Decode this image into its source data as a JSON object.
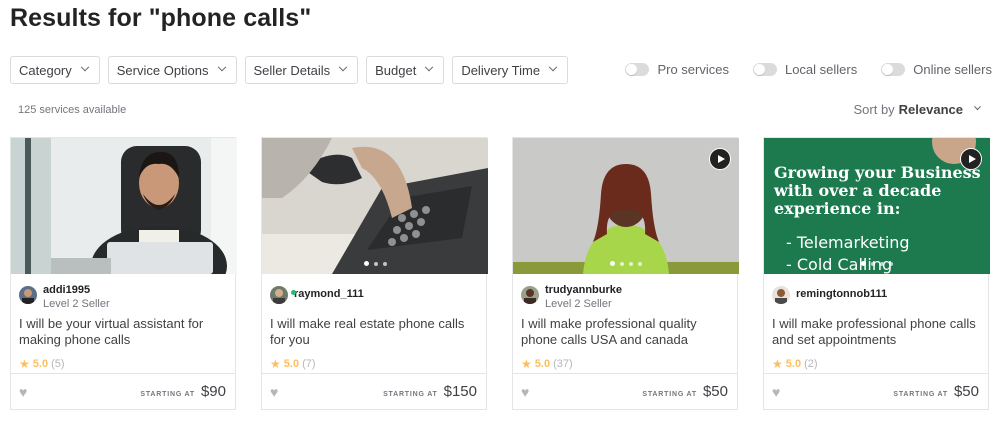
{
  "page": {
    "title": "Results for \"phone calls\""
  },
  "filters": [
    "Category",
    "Service Options",
    "Seller Details",
    "Budget",
    "Delivery Time"
  ],
  "toggles": [
    "Pro services",
    "Local sellers",
    "Online sellers"
  ],
  "results": {
    "count_label": "125 services available",
    "sort_prefix": "Sort by",
    "sort_value": "Relevance"
  },
  "cards": [
    {
      "seller": "addi1995",
      "level": "Level 2 Seller",
      "title": "I will be your virtual assistant for making phone calls",
      "rating": "5.0",
      "reviews": "(5)",
      "starting_label": "STARTING AT",
      "price": "$90"
    },
    {
      "seller": "raymond_111",
      "level": "",
      "title": "I will make real estate phone calls for you",
      "rating": "5.0",
      "reviews": "(7)",
      "starting_label": "STARTING AT",
      "price": "$150"
    },
    {
      "seller": "trudyannburke",
      "level": "Level 2 Seller",
      "title": "I will make professional quality phone calls USA and canada",
      "rating": "5.0",
      "reviews": "(37)",
      "starting_label": "STARTING AT",
      "price": "$50"
    },
    {
      "seller": "remingtonnob111",
      "level": "",
      "title": "I will make professional phone calls and set appointments",
      "rating": "5.0",
      "reviews": "(2)",
      "starting_label": "STARTING AT",
      "price": "$50"
    }
  ],
  "card4_image_text": {
    "headline": [
      "Growing your Business",
      "with over a decade",
      "experience in:"
    ],
    "bullets": [
      "- Telemarketing",
      "- Cold Calling"
    ]
  },
  "icons": {
    "chevron": "chevron-down-icon",
    "star": "star-icon",
    "heart": "heart-icon",
    "play": "play-icon"
  },
  "colors": {
    "star": "#ffbe5b",
    "online": "#1dbf73",
    "card4_bg": "#1c7a4e"
  }
}
